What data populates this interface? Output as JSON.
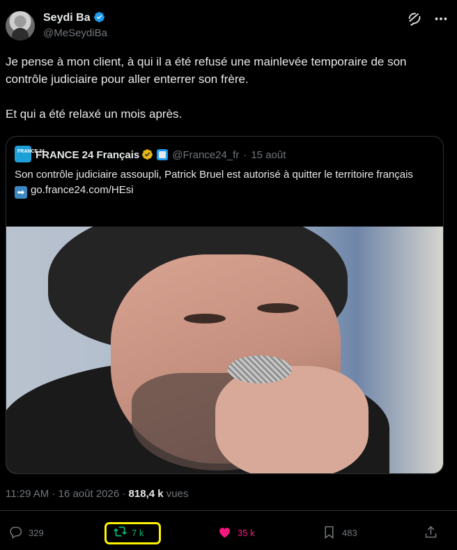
{
  "author": {
    "display_name": "Seydi Ba",
    "handle": "@MeSeydiBa",
    "avatar_icon": "avatar-lawyer-photo",
    "verified": true
  },
  "tweet": {
    "paragraphs": [
      "Je pense à mon client, à qui il a été refusé une mainlevée temporaire de son contrôle judiciaire pour aller enterrer son frère.",
      "Et qui a été relaxé un mois après."
    ]
  },
  "quote": {
    "logo_text": "FRANCE 24",
    "display_name": "FRANCE 24 Français",
    "handle": "@France24_fr",
    "separator": "·",
    "date": "15 août",
    "text": "Son contrôle judiciaire assoupli, Patrick Bruel est autorisé à quitter le territoire français",
    "link": "go.france24.com/HEsi",
    "media_description_icon": "photo-man-with-microphone"
  },
  "meta": {
    "time": "11:29 AM",
    "separator1": " · ",
    "date": "16 août 2026",
    "separator2": " · ",
    "views": "818,4 k",
    "views_label": " vues"
  },
  "actions": {
    "replies": "329",
    "retweets": "7 k",
    "likes": "35 k",
    "bookmarks": "483"
  },
  "colors": {
    "background": "#000000",
    "text": "#e7e9ea",
    "muted": "#71767b",
    "verified": "#1d9bf0",
    "retweet_active": "#00ba7c",
    "like_active": "#f91880",
    "highlight_box": "#fff200",
    "org_badge": "#e2b719"
  }
}
